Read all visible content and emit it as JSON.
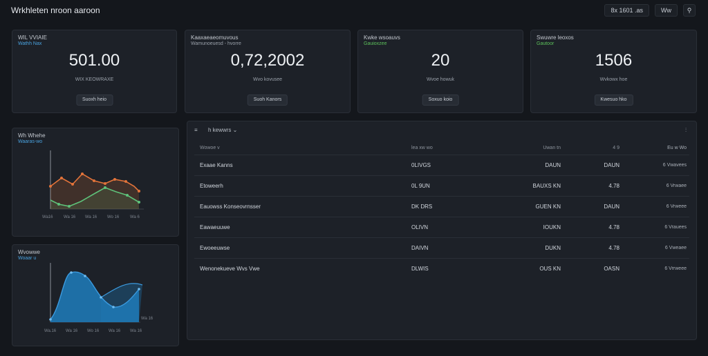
{
  "app": {
    "title": "Wrkhleten nroon aaroon"
  },
  "top_actions": [
    {
      "label": "8x 1601 .as"
    },
    {
      "label": "Ww"
    },
    {
      "label": "⚲"
    }
  ],
  "kpis": [
    {
      "title": "WIL VVIAIE",
      "sub": "Wathh Nax",
      "sub_color": "#4aa3e0",
      "value": "501.00",
      "caption": "WIX KEOWRAXE",
      "button": "Suoxh heio"
    },
    {
      "title": "Kaaxaeaeomuvous",
      "sub": "Wamunoeuesd - hvorre",
      "sub_color": "#9aa1aa",
      "value": "0,72,2002",
      "caption": "Wvo kovusee",
      "button": "Suoh Kanors"
    },
    {
      "title": "Kwke wsoauvs",
      "sub": "Gauioxzee",
      "sub_color": "#5cc05a",
      "value": "20",
      "caption": "Wvoe howuk",
      "button": "Soxuo koio"
    },
    {
      "title": "Swuwre leoxos",
      "sub": "Gautoor",
      "sub_color": "#5cc05a",
      "value": "1506",
      "caption": "Wvkowx hoe",
      "button": "Kwesuo hko"
    }
  ],
  "line_chart": {
    "title": "Wh Whehe",
    "sub": "Waaras-wo",
    "x_labels": [
      "Wa16",
      "Wa 16",
      "Wa 16",
      "Wo 16",
      "Wa 6",
      "Wa 16"
    ]
  },
  "area_chart": {
    "title": "Wvowwe",
    "sub": "Woaar u",
    "x_labels": [
      "Wa.16",
      "Wa 16",
      "Wo 16",
      "Wa 16",
      "Wa 16"
    ],
    "end_label": "Wa 16"
  },
  "table": {
    "toolbar": {
      "icon": "≡",
      "filter": "h kewwrs ⌄",
      "right_icon": "⫶"
    },
    "headers": [
      "Wowoe v",
      "lea xw wo",
      "Uwan tn",
      "4 9",
      "Eu w Wo"
    ],
    "rows": [
      [
        "Exaae Kanns",
        "0LIVGS",
        "DAUN",
        "DAUN",
        "6 Vwavees"
      ],
      [
        "Etoweerh",
        "0L 9UN",
        "BAUXS KN",
        "4.78",
        "6 Vrwaee"
      ],
      [
        "Eauowss Konseovrnsser",
        "DK DRS",
        "GUEN KN",
        "DAUN",
        "6 Vrweee"
      ],
      [
        "Eawaeuuwe",
        "OLIVN",
        "IOUKN",
        "4.78",
        "6 Vrauees"
      ],
      [
        "Ewoeeuwse",
        "DAIVN",
        "DUKN",
        "4.78",
        "6 Vweaee"
      ],
      [
        "Wenonekueve Wvs Vwe",
        "DLWIS",
        "OUS KN",
        "OASN",
        "6 Vrrweee"
      ]
    ]
  },
  "colors": {
    "accent_blue": "#4aa3e0",
    "line_orange": "#e2733a",
    "line_green": "#5ec27a",
    "area_blue": "#1f78b4"
  }
}
